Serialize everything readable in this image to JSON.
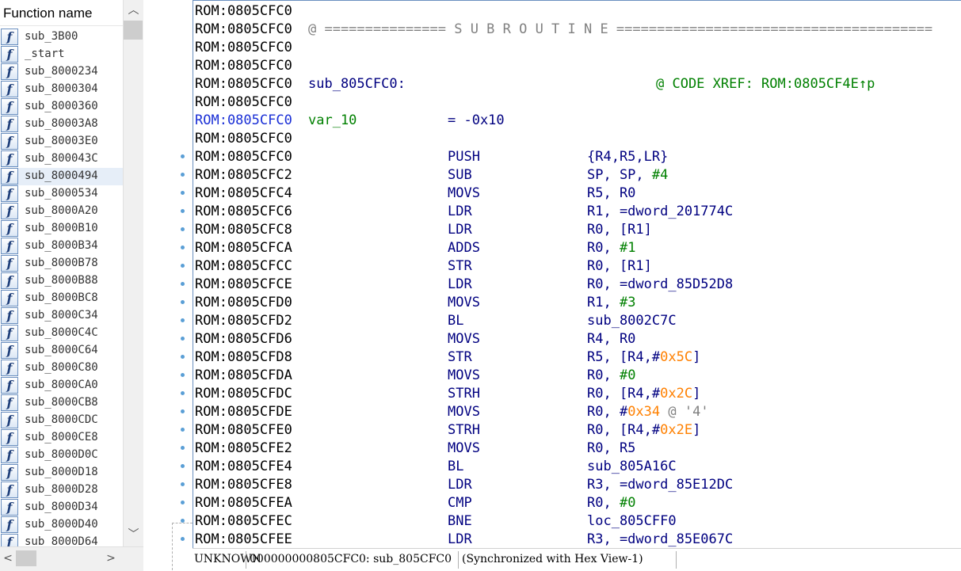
{
  "function_list": {
    "header": "Function name",
    "selected_index": 8,
    "items": [
      "sub_3B00",
      "_start",
      "sub_8000234",
      "sub_8000304",
      "sub_8000360",
      "sub_80003A8",
      "sub_80003E0",
      "sub_800043C",
      "sub_8000494",
      "sub_8000534",
      "sub_8000A20",
      "sub_8000B10",
      "sub_8000B34",
      "sub_8000B78",
      "sub_8000B88",
      "sub_8000BC8",
      "sub_8000C34",
      "sub_8000C4C",
      "sub_8000C64",
      "sub_8000C80",
      "sub_8000CA0",
      "sub_8000CB8",
      "sub_8000CDC",
      "sub_8000CE8",
      "sub_8000D0C",
      "sub_8000D18",
      "sub_8000D28",
      "sub_8000D34",
      "sub_8000D40",
      "sub_8000D64"
    ],
    "icon": "function-icon",
    "icon_glyph": "f",
    "scroll": {
      "up": "︿",
      "down": "﹀",
      "left": "<",
      "right": ">"
    }
  },
  "disassembly": {
    "subroutine_banner": "@ =============== S U B R O U T I N E =======================================",
    "label": "sub_805CFC0:",
    "xref": "@ CODE XREF: ROM:0805CF4E↑p",
    "var_name": "var_10",
    "var_value": "= -0x10",
    "lines": [
      {
        "addr": "ROM:0805CFC0"
      },
      {
        "addr": "ROM:0805CFC0",
        "kind": "banner"
      },
      {
        "addr": "ROM:0805CFC0"
      },
      {
        "addr": "ROM:0805CFC0"
      },
      {
        "addr": "ROM:0805CFC0",
        "kind": "label"
      },
      {
        "addr": "ROM:0805CFC0"
      },
      {
        "addr": "ROM:0805CFC0",
        "kind": "var",
        "highlight": true
      },
      {
        "addr": "ROM:0805CFC0"
      },
      {
        "addr": "ROM:0805CFC0",
        "mnem": "PUSH",
        "ops": [
          {
            "t": "{R4,R5,LR}"
          }
        ]
      },
      {
        "addr": "ROM:0805CFC2",
        "mnem": "SUB",
        "ops": [
          {
            "t": "SP, SP, "
          },
          {
            "t": "#4",
            "c": "num"
          }
        ]
      },
      {
        "addr": "ROM:0805CFC4",
        "mnem": "MOVS",
        "ops": [
          {
            "t": "R5, R0"
          }
        ]
      },
      {
        "addr": "ROM:0805CFC6",
        "mnem": "LDR",
        "ops": [
          {
            "t": "R1, =dword_201774C"
          }
        ]
      },
      {
        "addr": "ROM:0805CFC8",
        "mnem": "LDR",
        "ops": [
          {
            "t": "R0, [R1]"
          }
        ]
      },
      {
        "addr": "ROM:0805CFCA",
        "mnem": "ADDS",
        "ops": [
          {
            "t": "R0, "
          },
          {
            "t": "#1",
            "c": "num"
          }
        ]
      },
      {
        "addr": "ROM:0805CFCC",
        "mnem": "STR",
        "ops": [
          {
            "t": "R0, [R1]"
          }
        ]
      },
      {
        "addr": "ROM:0805CFCE",
        "mnem": "LDR",
        "ops": [
          {
            "t": "R0, =dword_85D52D8"
          }
        ]
      },
      {
        "addr": "ROM:0805CFD0",
        "mnem": "MOVS",
        "ops": [
          {
            "t": "R1, "
          },
          {
            "t": "#3",
            "c": "num"
          }
        ]
      },
      {
        "addr": "ROM:0805CFD2",
        "mnem": "BL",
        "ops": [
          {
            "t": "sub_8002C7C"
          }
        ]
      },
      {
        "addr": "ROM:0805CFD6",
        "mnem": "MOVS",
        "ops": [
          {
            "t": "R4, R0"
          }
        ]
      },
      {
        "addr": "ROM:0805CFD8",
        "mnem": "STR",
        "ops": [
          {
            "t": "R5, [R4,#"
          },
          {
            "t": "0x5C",
            "c": "hex"
          },
          {
            "t": "]"
          }
        ]
      },
      {
        "addr": "ROM:0805CFDA",
        "mnem": "MOVS",
        "ops": [
          {
            "t": "R0, "
          },
          {
            "t": "#0",
            "c": "num"
          }
        ]
      },
      {
        "addr": "ROM:0805CFDC",
        "mnem": "STRH",
        "ops": [
          {
            "t": "R0, [R4,#"
          },
          {
            "t": "0x2C",
            "c": "hex"
          },
          {
            "t": "]"
          }
        ]
      },
      {
        "addr": "ROM:0805CFDE",
        "mnem": "MOVS",
        "ops": [
          {
            "t": "R0, #"
          },
          {
            "t": "0x34",
            "c": "hex"
          },
          {
            "t": " @ '4'",
            "c": "grey"
          }
        ]
      },
      {
        "addr": "ROM:0805CFE0",
        "mnem": "STRH",
        "ops": [
          {
            "t": "R0, [R4,#"
          },
          {
            "t": "0x2E",
            "c": "hex"
          },
          {
            "t": "]"
          }
        ]
      },
      {
        "addr": "ROM:0805CFE2",
        "mnem": "MOVS",
        "ops": [
          {
            "t": "R0, R5"
          }
        ]
      },
      {
        "addr": "ROM:0805CFE4",
        "mnem": "BL",
        "ops": [
          {
            "t": "sub_805A16C"
          }
        ]
      },
      {
        "addr": "ROM:0805CFE8",
        "mnem": "LDR",
        "ops": [
          {
            "t": "R3, =dword_85E12DC"
          }
        ]
      },
      {
        "addr": "ROM:0805CFEA",
        "mnem": "CMP",
        "ops": [
          {
            "t": "R0, "
          },
          {
            "t": "#0",
            "c": "num"
          }
        ]
      },
      {
        "addr": "ROM:0805CFEC",
        "mnem": "BNE",
        "ops": [
          {
            "t": "loc_805CFF0"
          }
        ]
      },
      {
        "addr": "ROM:0805CFEE",
        "mnem": "LDR",
        "ops": [
          {
            "t": "R3, =dword_85E067C"
          }
        ]
      }
    ]
  },
  "status_bar": {
    "segment": "UNKNOWN",
    "location": "000000000805CFC0: sub_805CFC0",
    "sync": "(Synchronized with Hex View-1)"
  },
  "colors": {
    "address_highlight": "#1a2fd6",
    "mnemonic": "#000080",
    "number": "#008000",
    "hex_offset": "#ff8000",
    "comment": "#808080",
    "xref": "#008000"
  }
}
